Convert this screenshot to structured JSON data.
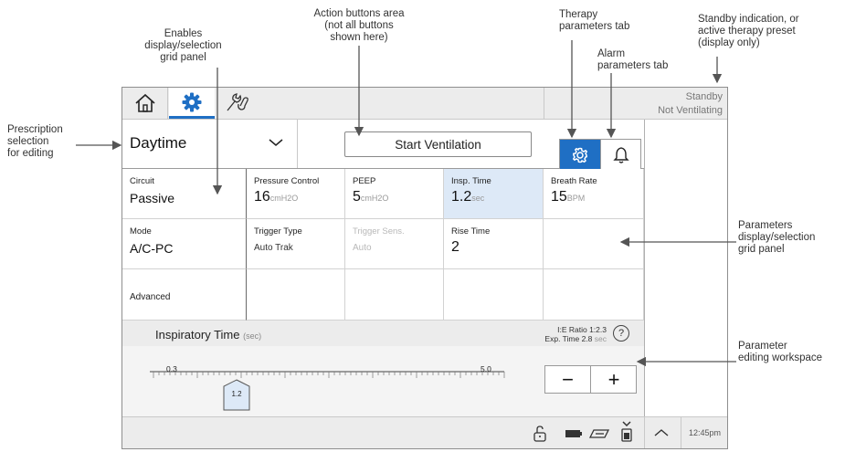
{
  "annotations": {
    "enables_grid": "Enables\ndisplay/selection\ngrid panel",
    "action_buttons": "Action buttons area\n(not all buttons\nshown here)",
    "therapy_tab": "Therapy\nparameters tab",
    "alarm_tab": "Alarm\nparameters tab",
    "standby_ann": "Standby indication, or\nactive therapy preset\n(display only)",
    "prescription": "Prescription\nselection\nfor editing",
    "params_grid": "Parameters\ndisplay/selection\ngrid panel",
    "workspace": "Parameter\nediting workspace"
  },
  "topbar": {
    "icons": [
      "home-icon",
      "gear-icon",
      "tools-icon"
    ],
    "status_line1": "Standby",
    "status_line2": "Not Ventilating"
  },
  "preset": {
    "label": "Daytime",
    "start_button": "Start Ventilation",
    "tabs": [
      "therapy-gear-icon",
      "alarm-bell-icon"
    ]
  },
  "grid": {
    "left": [
      {
        "label": "Circuit",
        "value": "Passive"
      },
      {
        "label": "Mode",
        "value": "A/C-PC"
      },
      {
        "label": "Advanced",
        "value": ""
      }
    ],
    "params": [
      {
        "label": "Pressure Control",
        "value": "16",
        "unit": "cmH2O"
      },
      {
        "label": "PEEP",
        "value": "5",
        "unit": "cmH2O"
      },
      {
        "label": "Insp. Time",
        "value": "1.2",
        "unit": "sec"
      },
      {
        "label": "Breath Rate",
        "value": "15",
        "unit": "BPM"
      },
      {
        "label": "Trigger Type",
        "value": "Auto Trak"
      },
      {
        "label": "Trigger Sens.",
        "value": "Auto"
      },
      {
        "label": "Rise Time",
        "value": "2"
      }
    ]
  },
  "workspace": {
    "title": "Inspiratory Time",
    "unit": "(sec)",
    "ie_ratio": "I:E Ratio 1:2.3",
    "exp_time_label": "Exp. Time 2.8",
    "exp_time_unit": "sec",
    "help": "?",
    "min": "0.3",
    "max": "5.0",
    "current": "1.2",
    "slider_fraction": 0.191,
    "minus": "−",
    "plus": "+"
  },
  "bottombar": {
    "icons": [
      "unlock-icon",
      "battery-icon",
      "ac-power-icon",
      "detachable-battery-icon",
      "chevron-up-icon"
    ],
    "time": "12:45pm"
  },
  "colors": {
    "accent": "#1f6fc4",
    "selected": "#dde9f7",
    "bar": "#ececec"
  }
}
